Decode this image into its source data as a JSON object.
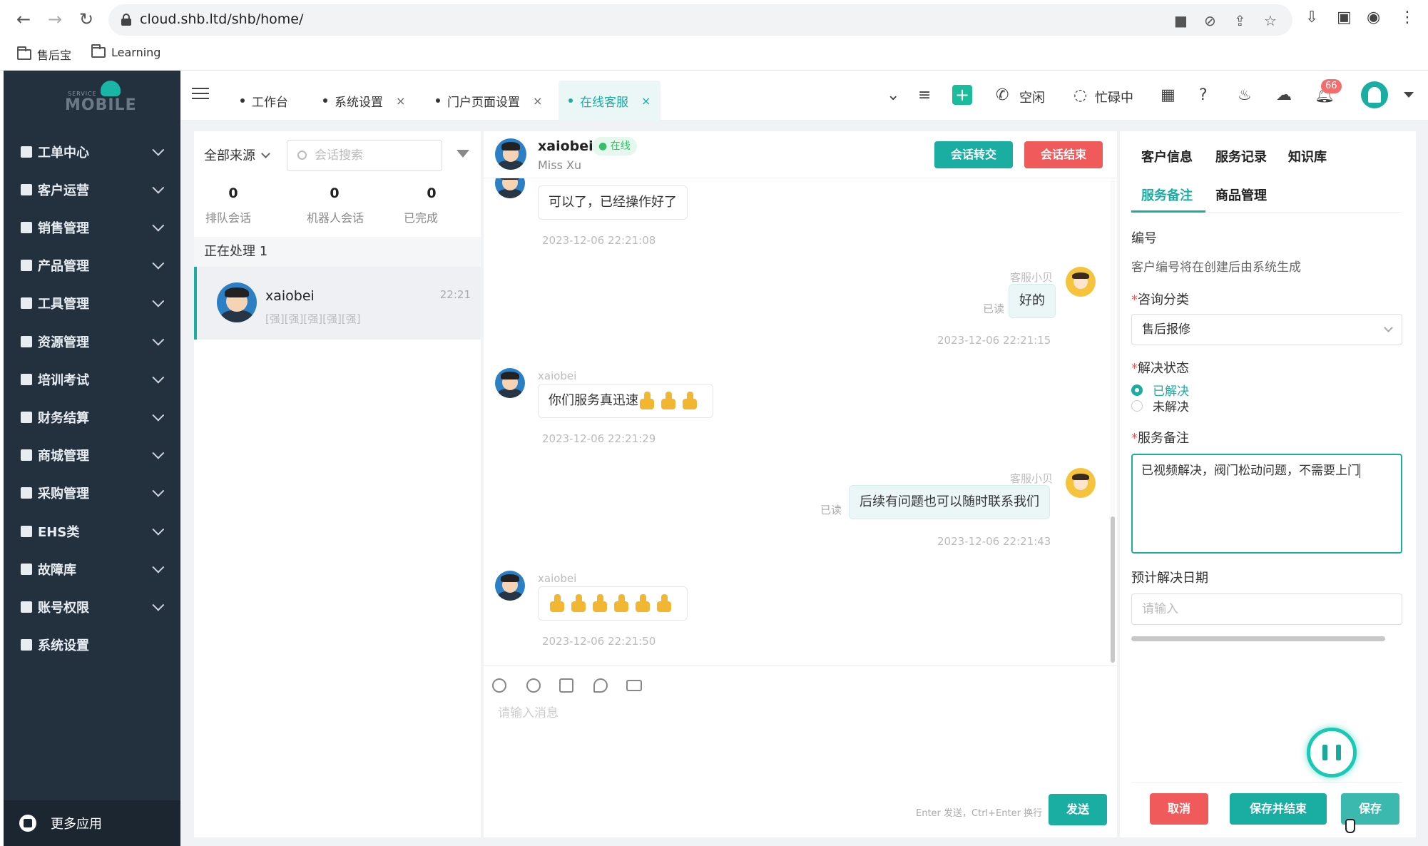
{
  "browser": {
    "url": "cloud.shb.ltd/shb/home/",
    "bookmarks": [
      "售后宝",
      "Learning"
    ]
  },
  "brand": {
    "logo_small": "SERVICE",
    "logo_text": "MOBILE",
    "accent": "#1aada2",
    "sidebar_bg": "#23303e",
    "danger": "#f05a5a"
  },
  "sidebar": {
    "items": [
      {
        "label": "工单中心",
        "icon": "ticket-icon"
      },
      {
        "label": "客户运营",
        "icon": "customer-icon"
      },
      {
        "label": "销售管理",
        "icon": "sales-icon"
      },
      {
        "label": "产品管理",
        "icon": "product-icon"
      },
      {
        "label": "工具管理",
        "icon": "tool-icon"
      },
      {
        "label": "资源管理",
        "icon": "home-icon"
      },
      {
        "label": "培训考试",
        "icon": "graduation-icon"
      },
      {
        "label": "财务结算",
        "icon": "finance-icon"
      },
      {
        "label": "商城管理",
        "icon": "shop-icon"
      },
      {
        "label": "采购管理",
        "icon": "purchase-icon"
      },
      {
        "label": "EHS类",
        "icon": "ehs-icon"
      },
      {
        "label": "故障库",
        "icon": "fault-icon"
      },
      {
        "label": "账号权限",
        "icon": "shield-icon"
      },
      {
        "label": "系统设置",
        "icon": "gear-icon"
      }
    ],
    "more_apps": "更多应用"
  },
  "topbar": {
    "tabs": [
      {
        "label": "工作台",
        "closable": false
      },
      {
        "label": "系统设置",
        "closable": true
      },
      {
        "label": "门户页面设置",
        "closable": true
      },
      {
        "label": "在线客服",
        "closable": true,
        "active": true
      }
    ],
    "close_glyph": "×",
    "status_idle": "空闲",
    "status_busy": "忙碌中",
    "notification_count": "66"
  },
  "conversations": {
    "source_filter": "全部来源",
    "search_placeholder": "会话搜索",
    "stats": [
      {
        "value": "0",
        "label": "排队会话"
      },
      {
        "value": "0",
        "label": "机器人会话"
      },
      {
        "value": "0",
        "label": "已完成"
      }
    ],
    "processing_label": "正在处理 1",
    "items": [
      {
        "name": "xaiobei",
        "time": "22:21",
        "preview": "[强][强][强][强][强]"
      }
    ]
  },
  "chat": {
    "customer_name": "xaiobei",
    "online_label": "在线",
    "customer_sub": "Miss Xu",
    "transfer_button": "会话转交",
    "end_button": "会话结束",
    "messages": [
      {
        "from": "customer",
        "sender": "xaiobei",
        "text": "可以了，已经操作好了",
        "time": "2023-12-06 22:21:08"
      },
      {
        "from": "agent",
        "sender": "客服小贝",
        "text": "好的",
        "time": "2023-12-06 22:21:15",
        "read": "已读"
      },
      {
        "from": "customer",
        "sender": "xaiobei",
        "text": "你们服务真迅速",
        "thumbs": 3,
        "time": "2023-12-06 22:21:29"
      },
      {
        "from": "agent",
        "sender": "客服小贝",
        "text": "后续有问题也可以随时联系我们",
        "time": "2023-12-06 22:21:43",
        "read": "已读"
      },
      {
        "from": "customer",
        "sender": "xaiobei",
        "text": "",
        "thumbs": 6,
        "time": "2023-12-06 22:21:50"
      }
    ],
    "composer_placeholder": "请输入消息",
    "send_hint": "Enter 发送，Ctrl+Enter 换行",
    "send_button": "发送"
  },
  "info": {
    "tabs": [
      "客户信息",
      "服务记录",
      "知识库"
    ],
    "sub_tabs": [
      "服务备注",
      "商品管理"
    ],
    "number_label": "编号",
    "number_helper": "客户编号将在创建后由系统生成",
    "category_label": "咨询分类",
    "category_value": "售后报修",
    "resolve_label": "解决状态",
    "resolve_options": [
      {
        "label": "已解决",
        "checked": true
      },
      {
        "label": "未解决",
        "checked": false
      }
    ],
    "note_label": "服务备注",
    "note_value": "已视频解决，阀门松动问题，不需要上门",
    "date_label": "预计解决日期",
    "date_placeholder": "请输入",
    "cancel_button": "取消",
    "save_end_button": "保存并结束",
    "save_button": "保存"
  }
}
